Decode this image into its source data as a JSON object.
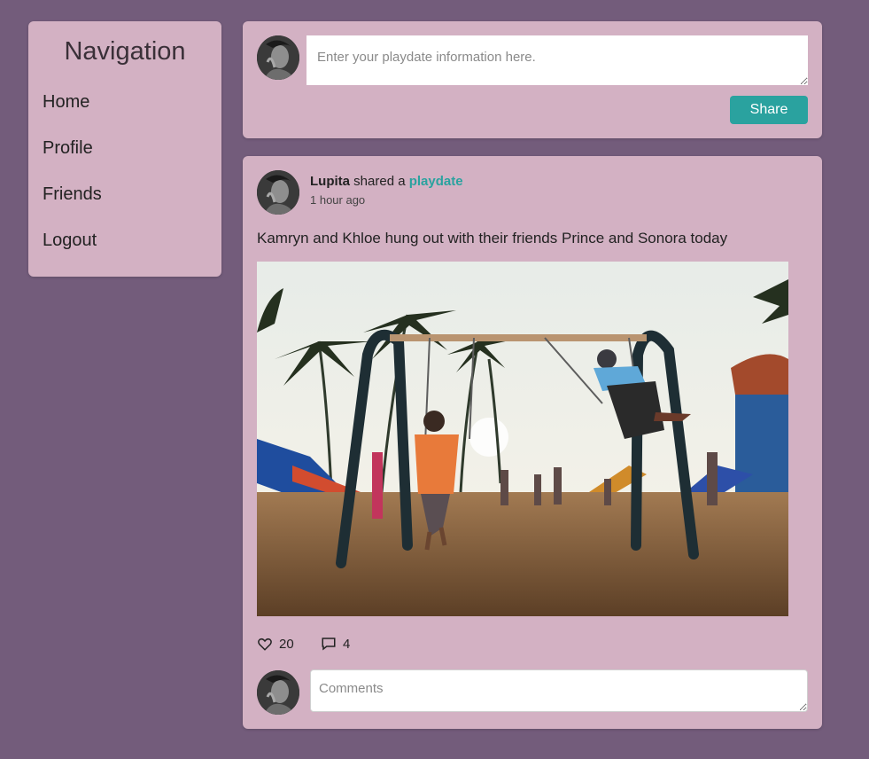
{
  "nav": {
    "title": "Navigation",
    "items": [
      {
        "label": "Home"
      },
      {
        "label": "Profile"
      },
      {
        "label": "Friends"
      },
      {
        "label": "Logout"
      }
    ]
  },
  "composer": {
    "placeholder": "Enter your playdate information here.",
    "value": "",
    "share_label": "Share"
  },
  "post": {
    "author": "Lupita",
    "action_text": " shared a ",
    "link_text": "playdate",
    "time": "1 hour ago",
    "text": "Kamryn and Khloe hung out with their friends Prince and Sonora today",
    "likes": "20",
    "comments": "4",
    "comment_placeholder": "Comments",
    "comment_value": ""
  },
  "colors": {
    "background": "#735c7b",
    "card": "#d3b1c3",
    "accent": "#2aa29f"
  },
  "icons": {
    "avatar": "user-avatar",
    "like": "heart-icon",
    "comment": "comment-icon"
  }
}
